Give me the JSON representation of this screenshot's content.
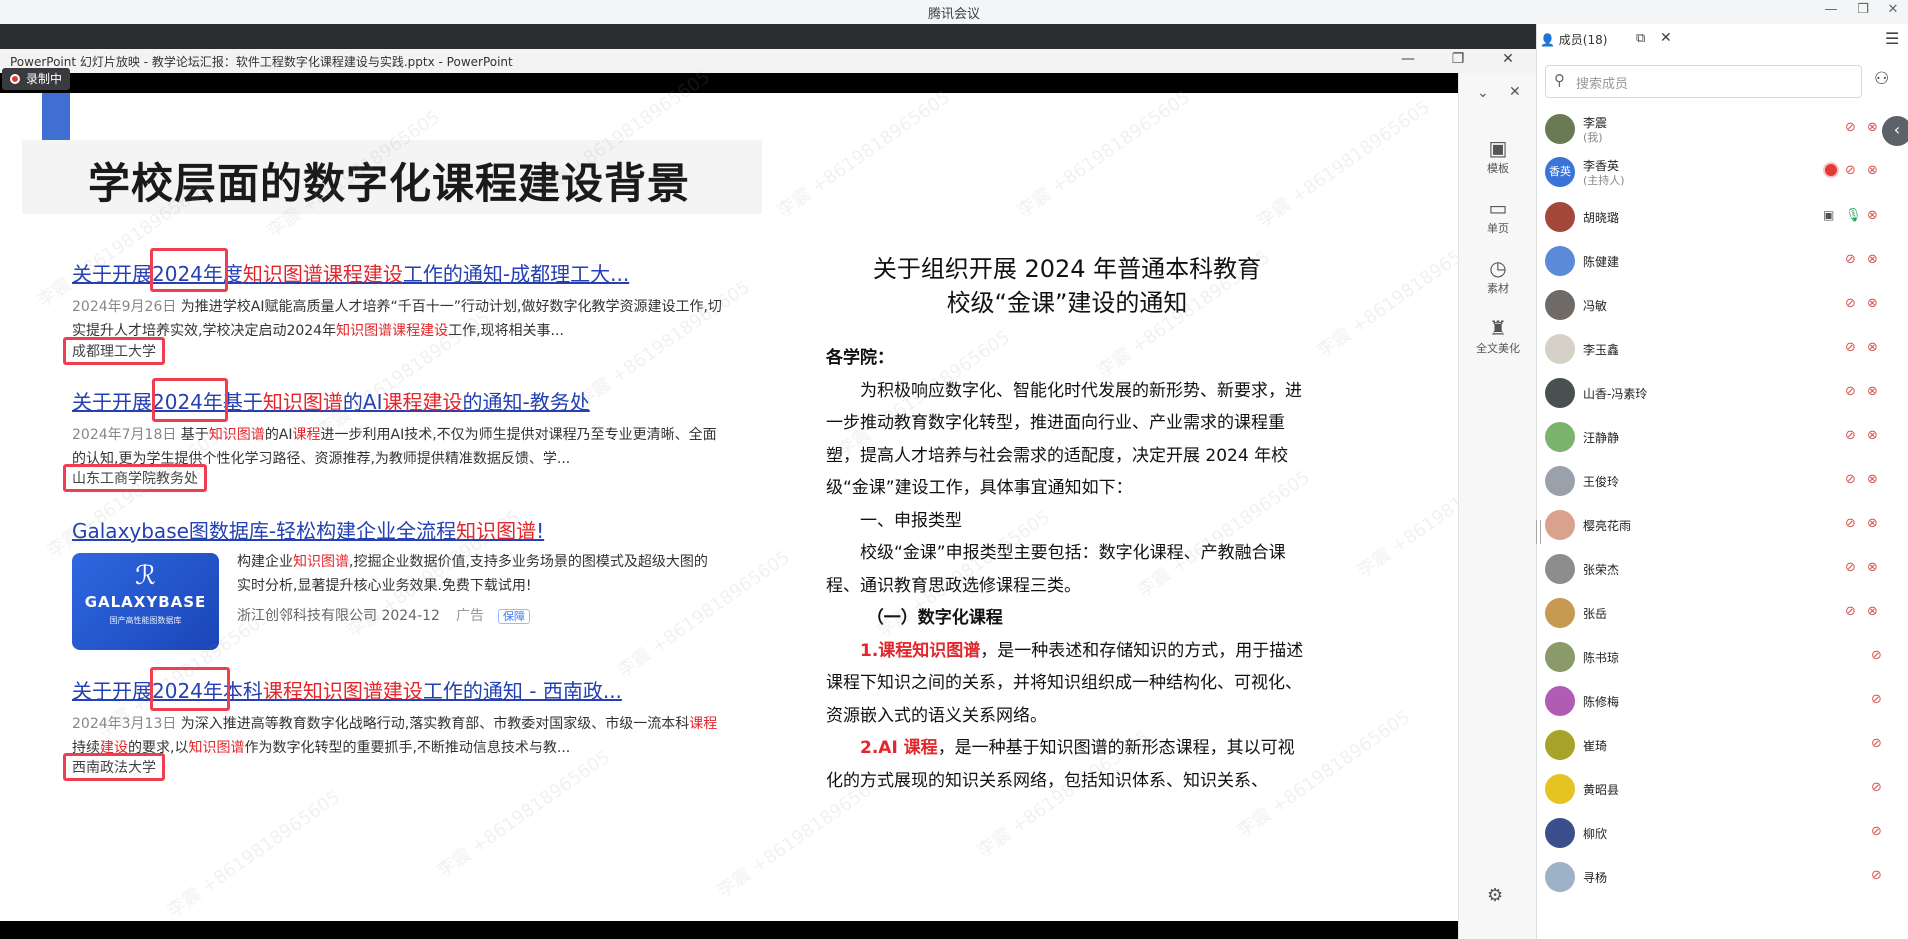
{
  "app": {
    "title": "腾讯会议"
  },
  "ppt": {
    "window_title": "PowerPoint 幻灯片放映 - 教学论坛汇报：软件工程数字化课程建设与实践.pptx - PowerPoint",
    "recording": "录制中",
    "tools": [
      {
        "label": "模板",
        "icon": "template-icon"
      },
      {
        "label": "单页",
        "icon": "single-page-icon"
      },
      {
        "label": "素材",
        "icon": "assets-icon"
      },
      {
        "label": "全文美化",
        "icon": "beautify-icon"
      }
    ]
  },
  "slide": {
    "title": "学校层面的数字化课程建设背景",
    "results": [
      {
        "title_parts": [
          "关于开展",
          "2024年",
          "度",
          "知识图谱课程建设",
          "工作的通知-成都理工大..."
        ],
        "date": "2024年9月26日",
        "desc_a": " 为推进学校AI赋能高质量人才培养“千百十一”行动计划,做好数字化教学资源建设工作,切实提升人才培养实效,学校决定启动2024年",
        "desc_red": "知识图谱课程建设",
        "desc_b": "工作,现将相关事...",
        "source": "成都理工大学"
      },
      {
        "title_parts": [
          "关于开展",
          "2024年",
          "基于",
          "知识图谱",
          "的AI",
          "课程建设",
          "的通知-教务处"
        ],
        "date": "2024年7月18日",
        "desc_a": " 基于",
        "desc_red": "知识图谱",
        "desc_b": "的AI",
        "desc_red2": "课程",
        "desc_c": "进一步利用AI技术,不仅为师生提供对课程乃至专业更清晰、全面的认知,更为学生提供个性化学习路径、资源推荐,为教师提供精准数据反馈、学...",
        "source": "山东工商学院教务处"
      },
      {
        "title_parts": [
          "关于开展",
          "2024年",
          "本科",
          "课程知识图谱建设",
          "工作的通知 - 西南政..."
        ],
        "date": "2024年3月13日",
        "desc_a": " 为深入推进高等教育数字化战略行动,落实教育部、市教委对国家级、市级一流本科",
        "desc_red": "课程",
        "desc_b": "持续",
        "desc_red2": "建设",
        "desc_c": "的要求,以",
        "desc_red3": "知识图谱",
        "desc_d": "作为数字化转型的重要抓手,不断推动信息技术与教...",
        "source": "西南政法大学"
      }
    ],
    "ad": {
      "title_a": "Galaxybase图数据库-轻松构建企业全流程",
      "title_red": "知识图谱",
      "title_b": "!",
      "logo_name": "GALAXYBASE",
      "logo_sub": "国产高性能图数据库",
      "desc_a": "构建企业",
      "desc_red": "知识图谱",
      "desc_b": ",挖掘企业数据价值,支持多业务场景的图模式及超级大图的实时分析,显著提升核心业务效果.免费下载试用!",
      "company": "浙江创邻科技有限公司 2024-12",
      "ad_label": "广告",
      "badge": "保障"
    },
    "document": {
      "title_line1": "关于组织开展 2024 年普通本科教育",
      "title_line2": "校级“金课”建设的通知",
      "salutation": "各学院：",
      "para1": "为积极响应数字化、智能化时代发展的新形势、新要求，进一步推动教育数字化转型，推进面向行业、产业需求的课程重塑，提高人才培养与社会需求的适配度，决定开展 2024 年校级“金课”建设工作，具体事宜通知如下：",
      "section1": "一、申报类型",
      "para2": "校级“金课”申报类型主要包括：数字化课程、产教融合课程、通识教育思政选修课程三类。",
      "sub1": "（一）数字化课程",
      "item1_red": "1.课程知识图谱",
      "item1": "，是一种表述和存储知识的方式，用于描述课程下知识之间的关系，并将知识组织成一种结构化、可视化、资源嵌入式的语义关系网络。",
      "item2_red": "2.AI 课程",
      "item2": "，是一种基于知识图谱的新形态课程，其以可视化的方式展现的知识关系网络，包括知识体系、知识关系、"
    },
    "watermark": "李震 +8619818965605"
  },
  "panel": {
    "tab_label": "成员(18)",
    "search_placeholder": "搜索成员",
    "members": [
      {
        "name": "李震",
        "sub": "(我)",
        "avatar_color": "#6a7a52"
      },
      {
        "name": "李香英",
        "sub": "(主持人)",
        "avatar_color": "#3a74d9",
        "avatar_text": "香英",
        "recording": true
      },
      {
        "name": "胡晓璐",
        "avatar_color": "#a5463a",
        "mic_on": true
      },
      {
        "name": "陈健建",
        "avatar_color": "#5b8bd8"
      },
      {
        "name": "冯敏",
        "avatar_color": "#6f6a66"
      },
      {
        "name": "李玉鑫",
        "avatar_color": "#d6d1c6"
      },
      {
        "name": "山香-冯素玲",
        "avatar_color": "#4a4f52"
      },
      {
        "name": "汪静静",
        "avatar_color": "#7cb36c"
      },
      {
        "name": "王俊玲",
        "avatar_color": "#9aa1aa"
      },
      {
        "name": "樱亮花雨",
        "avatar_color": "#d9a28c"
      },
      {
        "name": "张荣杰",
        "avatar_color": "#8d8d8d"
      },
      {
        "name": "张岳",
        "avatar_color": "#c79a52"
      },
      {
        "name": "陈书琼",
        "avatar_color": "#8a9a6a"
      },
      {
        "name": "陈修梅",
        "avatar_color": "#b05cb5"
      },
      {
        "name": "崔琦",
        "avatar_color": "#a8a32a"
      },
      {
        "name": "黄昭县",
        "avatar_color": "#e5c321"
      },
      {
        "name": "柳欣",
        "avatar_color": "#3a4f8c"
      },
      {
        "name": "寻杨",
        "avatar_color": "#9eb2c7"
      }
    ]
  }
}
